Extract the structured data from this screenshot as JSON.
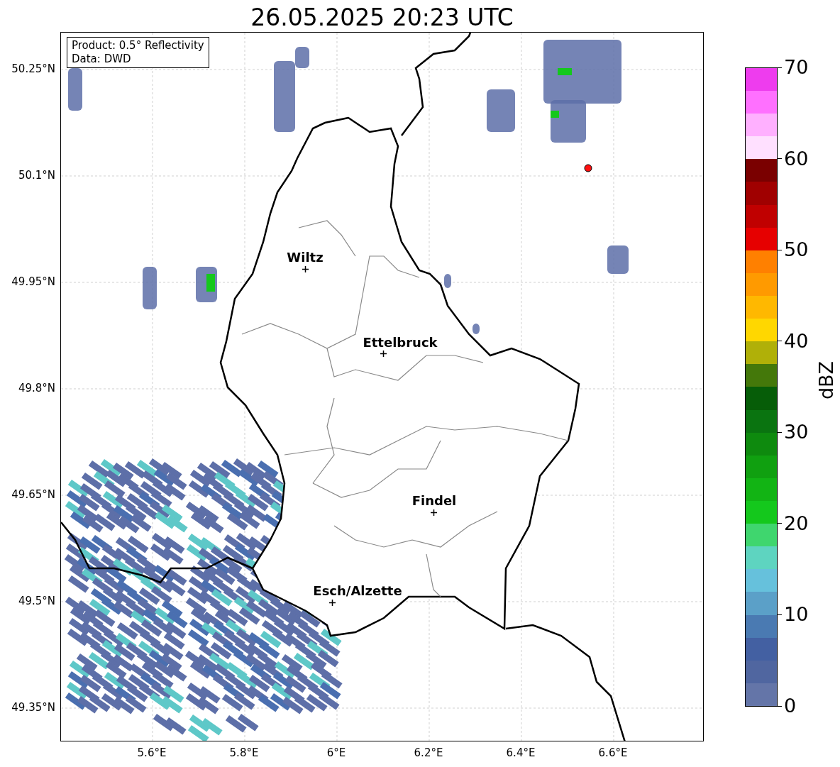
{
  "title": "26.05.2025 20:23 UTC",
  "info_box": [
    "Product: 0.5° Reflectivity",
    "Data: DWD"
  ],
  "y_ticks": [
    "50.25°N",
    "50.1°N",
    "49.95°N",
    "49.8°N",
    "49.65°N",
    "49.5°N",
    "49.35°N"
  ],
  "x_ticks": [
    "5.6°E",
    "5.8°E",
    "6°E",
    "6.2°E",
    "6.4°E",
    "6.6°E"
  ],
  "cities": [
    {
      "name": "Wiltz"
    },
    {
      "name": "Ettelbruck"
    },
    {
      "name": "Findel"
    },
    {
      "name": "Esch/Alzette"
    }
  ],
  "colorbar": {
    "label": "dBZ",
    "ticks": [
      "70",
      "60",
      "50",
      "40",
      "30",
      "20",
      "10",
      "0"
    ]
  }
}
